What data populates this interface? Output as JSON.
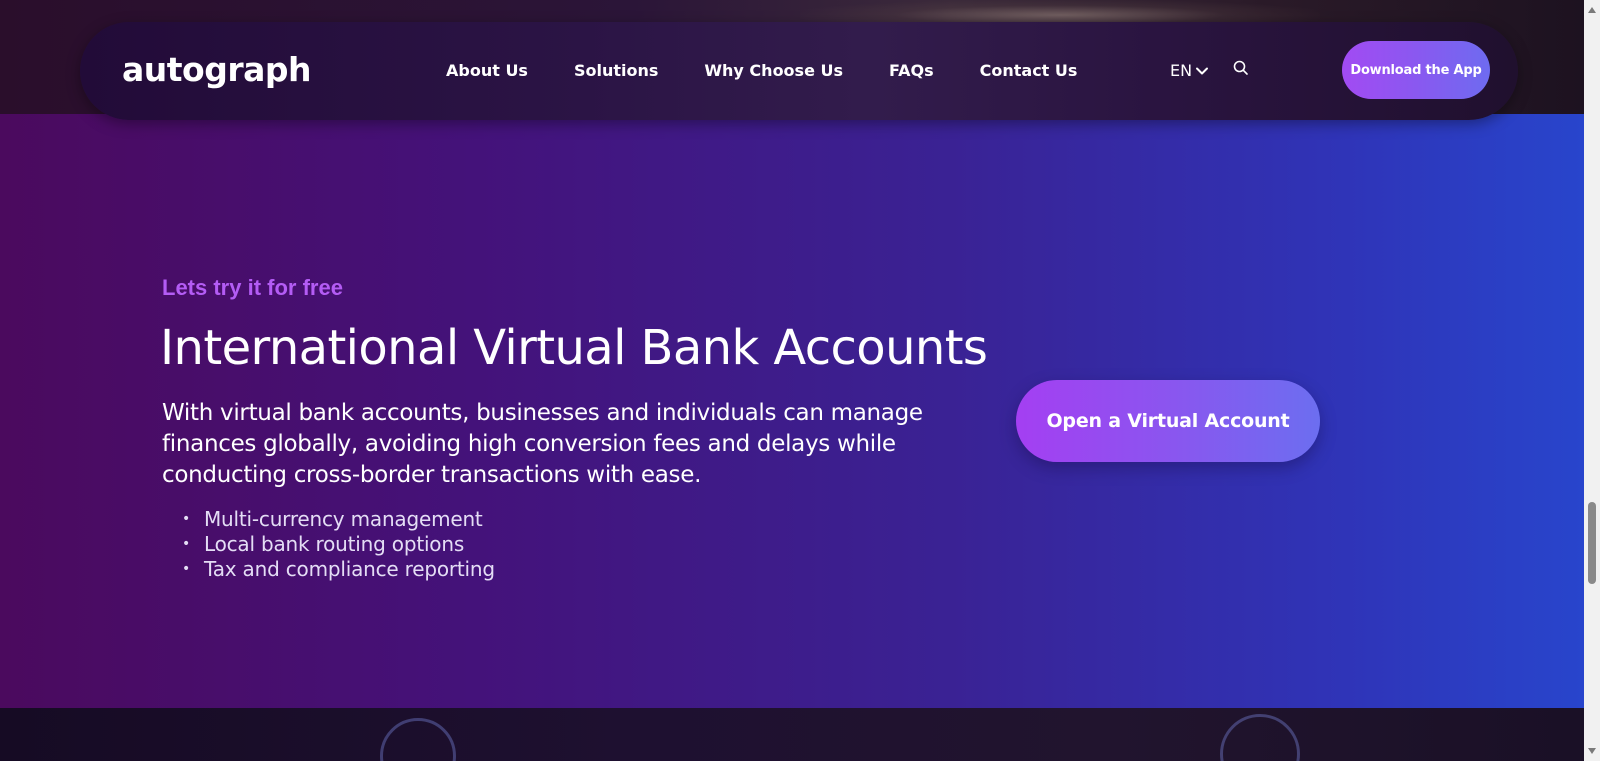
{
  "nav": {
    "logo_text": "autograph",
    "links": [
      "About Us",
      "Solutions",
      "Why Choose Us",
      "FAQs",
      "Contact Us"
    ],
    "language": "EN",
    "download_label": "Download the App"
  },
  "hero": {
    "eyebrow": "Lets try it for free",
    "title": "International Virtual Bank Accounts",
    "description": "With virtual bank accounts, businesses and individuals can manage finances globally, avoiding high conversion fees and delays while conducting cross-border transactions with ease.",
    "features": [
      "Multi-currency management",
      "Local bank routing options",
      "Tax and compliance reporting"
    ],
    "bullet": "•",
    "cta_label": "Open a Virtual Account"
  },
  "colors": {
    "accent_purple": "#b45cf5",
    "button_gradient_start": "#a43ff2",
    "button_gradient_end": "#6c6ef0"
  },
  "icons": {
    "lang_dropdown": "chevron-down-icon",
    "search": "search-icon",
    "scroll_up": "triangle-up-icon",
    "scroll_down": "triangle-down-icon"
  }
}
